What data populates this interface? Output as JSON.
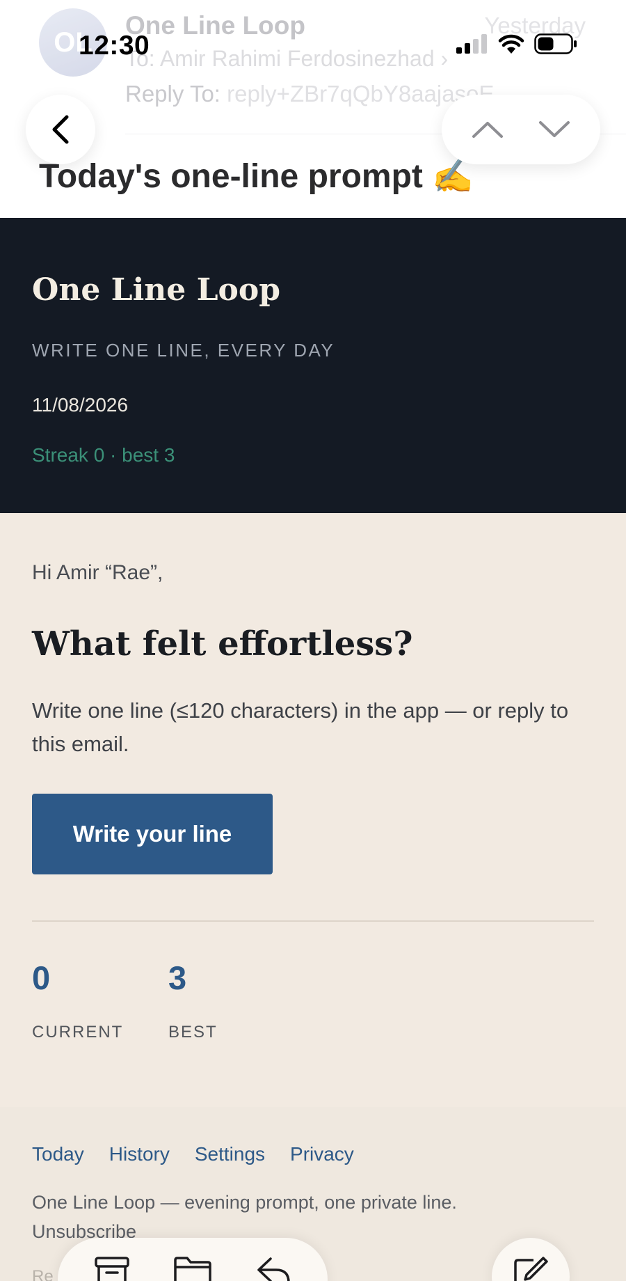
{
  "status_bar": {
    "time": "12:30"
  },
  "mail_header": {
    "sender_initials": "OL",
    "sender_name": "One Line Loop",
    "date": "Yesterday",
    "to_label": "To:",
    "to_value": "Amir Rahimi Ferdosinezhad",
    "reply_to_label": "Reply To:",
    "reply_to_value": "reply+ZBr7qQbY8aajasoE",
    "subject": "Today's one-line prompt ✍️"
  },
  "email": {
    "brand": "One Line Loop",
    "tagline": "WRITE ONE LINE, EVERY DAY",
    "date": "11/08/2026",
    "streak": "Streak 0 · best 3",
    "greeting": "Hi Amir “Rae”,",
    "question": "What felt effortless?",
    "instructions": "Write one line (≤120 characters) in the app — or reply to this email.",
    "cta_label": "Write your line",
    "stats": [
      {
        "value": "0",
        "label": "CURRENT"
      },
      {
        "value": "3",
        "label": "BEST"
      }
    ],
    "footer_links": [
      "Today",
      "History",
      "Settings",
      "Privacy"
    ],
    "footer_note": "One Line Loop — evening prompt, one private line.",
    "unsubscribe": "Unsubscribe",
    "footer_faded": "Re"
  },
  "colors": {
    "hero_bg": "#141a24",
    "body_bg": "#f2eae1",
    "accent_blue": "#2d5988",
    "streak_green": "#3b9078"
  },
  "icons": {
    "back": "chevron-left-icon",
    "prev": "chevron-up-icon",
    "next": "chevron-down-icon",
    "archive": "archive-icon",
    "move": "folder-icon",
    "reply": "reply-icon",
    "compose": "compose-icon"
  }
}
